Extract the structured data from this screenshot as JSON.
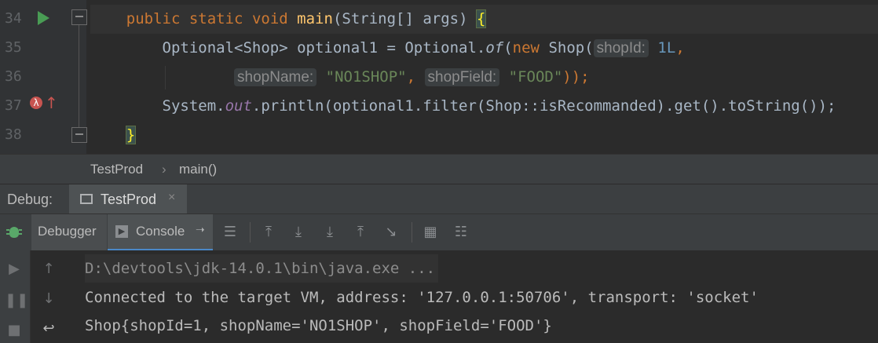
{
  "editor": {
    "lines": [
      {
        "num": "34"
      },
      {
        "num": "35"
      },
      {
        "num": "36"
      },
      {
        "num": "37"
      },
      {
        "num": "38"
      }
    ],
    "code": {
      "l34": {
        "kw1": "public",
        "kw2": "static",
        "kw3": "void",
        "fn": "main",
        "rest": "(String[] args) ",
        "brace": "{"
      },
      "l35": {
        "pre": "Optional<Shop> optional1 = Optional.",
        "of": "of",
        "paren": "(",
        "new": "new",
        "shop": " Shop(",
        "hint_shopId": "shopId:",
        "num": "1L",
        "comma": ","
      },
      "l36": {
        "hint_shopName": "shopName:",
        "str1": "\"NO1SHOP\"",
        "comma": ", ",
        "hint_shopField": "shopField:",
        "str2": "\"FOOD\"",
        "end": "));"
      },
      "l37": {
        "pre": "System.",
        "out": "out",
        "rest": ".println(optional1.filter(Shop::isRecommanded).get().toString());"
      },
      "l38": {
        "brace": "}"
      }
    }
  },
  "breadcrumb": {
    "class": "TestProd",
    "separator": "›",
    "method": "main()"
  },
  "debug": {
    "title": "Debug:",
    "tab_label": "TestProd",
    "close": "×",
    "subtabs": {
      "debugger": "Debugger",
      "console": "Console"
    }
  },
  "console": {
    "lines": [
      "D:\\devtools\\jdk-14.0.1\\bin\\java.exe ...",
      "Connected to the target VM, address: '127.0.0.1:50706', transport: 'socket'",
      "Shop{shopId=1, shopName='NO1SHOP', shopField='FOOD'}"
    ]
  }
}
